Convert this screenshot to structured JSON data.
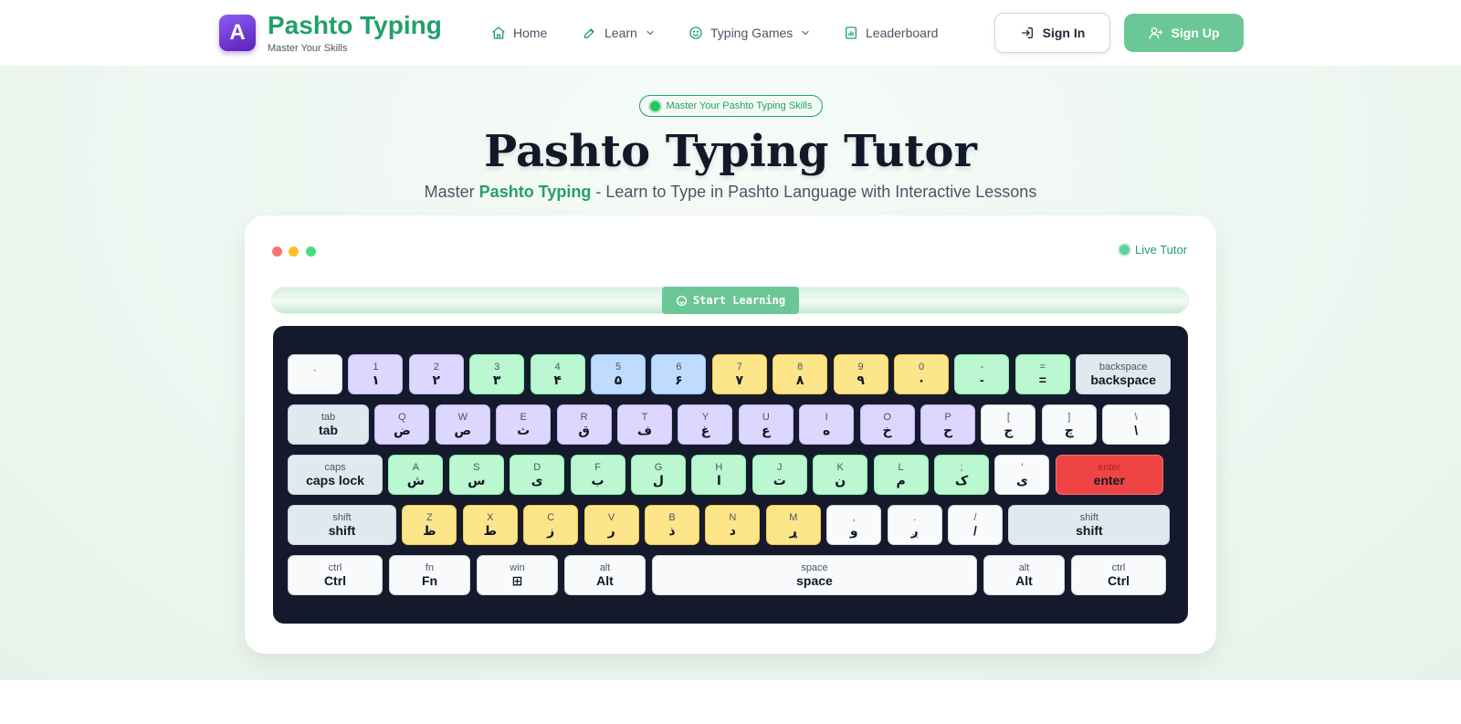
{
  "nav": {
    "logo_letter": "A",
    "brand_title": "Pashto Typing",
    "brand_sub": "Master Your Skills",
    "items": [
      {
        "label": "Home"
      },
      {
        "label": "Learn"
      },
      {
        "label": "Typing Games"
      },
      {
        "label": "Leaderboard"
      }
    ],
    "sign_in": "Sign In",
    "sign_up": "Sign Up"
  },
  "hero": {
    "pill": "Master Your Pashto Typing Skills",
    "title": "Pashto Typing Tutor",
    "sub_pre": "Master ",
    "sub_hl": "Pashto Typing",
    "sub_post": " - Learn to Type in Pashto Language with Interactive Lessons"
  },
  "card": {
    "live_label": "Live Tutor",
    "start_label": "Start Learning"
  },
  "colors": {
    "brand_green": "#22a06b",
    "button_green": "#6cc796",
    "purple": "#ddd6fe",
    "green": "#bbf7d0",
    "blue": "#bfdbfe",
    "yellow": "#fde68a",
    "gray": "#e2e8f0",
    "red": "#ef4444",
    "keyboard_bg": "#141a2c"
  },
  "keyboard": {
    "rows": [
      [
        {
          "top": "`",
          "bottom": "",
          "color": "white"
        },
        {
          "top": "1",
          "bottom": "١",
          "color": "purple"
        },
        {
          "top": "2",
          "bottom": "٢",
          "color": "purple"
        },
        {
          "top": "3",
          "bottom": "٣",
          "color": "green"
        },
        {
          "top": "4",
          "bottom": "۴",
          "color": "green"
        },
        {
          "top": "5",
          "bottom": "۵",
          "color": "blue"
        },
        {
          "top": "6",
          "bottom": "۶",
          "color": "blue"
        },
        {
          "top": "7",
          "bottom": "٧",
          "color": "yellow"
        },
        {
          "top": "8",
          "bottom": "٨",
          "color": "yellow"
        },
        {
          "top": "9",
          "bottom": "٩",
          "color": "yellow"
        },
        {
          "top": "0",
          "bottom": "٠",
          "color": "yellow"
        },
        {
          "top": "-",
          "bottom": "-",
          "color": "green"
        },
        {
          "top": "=",
          "bottom": "=",
          "color": "green"
        },
        {
          "top": "backspace",
          "bottom": "backspace",
          "color": "gray"
        }
      ],
      [
        {
          "top": "tab",
          "bottom": "tab",
          "color": "gray"
        },
        {
          "top": "Q",
          "bottom": "ض",
          "color": "purple"
        },
        {
          "top": "W",
          "bottom": "ص",
          "color": "purple"
        },
        {
          "top": "E",
          "bottom": "ث",
          "color": "purple"
        },
        {
          "top": "R",
          "bottom": "ق",
          "color": "purple"
        },
        {
          "top": "T",
          "bottom": "ف",
          "color": "purple"
        },
        {
          "top": "Y",
          "bottom": "غ",
          "color": "purple"
        },
        {
          "top": "U",
          "bottom": "ع",
          "color": "purple"
        },
        {
          "top": "I",
          "bottom": "ه",
          "color": "purple"
        },
        {
          "top": "O",
          "bottom": "خ",
          "color": "purple"
        },
        {
          "top": "P",
          "bottom": "ح",
          "color": "purple"
        },
        {
          "top": "[",
          "bottom": "ج",
          "color": "white"
        },
        {
          "top": "]",
          "bottom": "چ",
          "color": "white"
        },
        {
          "top": "\\",
          "bottom": "\\",
          "color": "white"
        }
      ],
      [
        {
          "top": "caps",
          "bottom": "caps lock",
          "color": "gray"
        },
        {
          "top": "A",
          "bottom": "ش",
          "color": "green"
        },
        {
          "top": "S",
          "bottom": "س",
          "color": "green"
        },
        {
          "top": "D",
          "bottom": "ی",
          "color": "green"
        },
        {
          "top": "F",
          "bottom": "ب",
          "color": "green"
        },
        {
          "top": "G",
          "bottom": "ل",
          "color": "green"
        },
        {
          "top": "H",
          "bottom": "ا",
          "color": "green"
        },
        {
          "top": "J",
          "bottom": "ت",
          "color": "green"
        },
        {
          "top": "K",
          "bottom": "ن",
          "color": "green"
        },
        {
          "top": "L",
          "bottom": "م",
          "color": "green"
        },
        {
          "top": ";",
          "bottom": "ک",
          "color": "green"
        },
        {
          "top": "'",
          "bottom": "ی",
          "color": "white"
        },
        {
          "top": "enter",
          "bottom": "enter",
          "color": "red"
        }
      ],
      [
        {
          "top": "shift",
          "bottom": "shift",
          "color": "gray"
        },
        {
          "top": "Z",
          "bottom": "ظ",
          "color": "yellow"
        },
        {
          "top": "X",
          "bottom": "ط",
          "color": "yellow"
        },
        {
          "top": "C",
          "bottom": "ز",
          "color": "yellow"
        },
        {
          "top": "V",
          "bottom": "ر",
          "color": "yellow"
        },
        {
          "top": "B",
          "bottom": "ذ",
          "color": "yellow"
        },
        {
          "top": "N",
          "bottom": "د",
          "color": "yellow"
        },
        {
          "top": "M",
          "bottom": "ړ",
          "color": "yellow"
        },
        {
          "top": ",",
          "bottom": "و",
          "color": "white"
        },
        {
          "top": ".",
          "bottom": "ږ",
          "color": "white"
        },
        {
          "top": "/",
          "bottom": "/",
          "color": "white"
        },
        {
          "top": "shift",
          "bottom": "shift",
          "color": "gray"
        }
      ],
      [
        {
          "top": "ctrl",
          "bottom": "Ctrl",
          "color": "white"
        },
        {
          "top": "fn",
          "bottom": "Fn",
          "color": "white"
        },
        {
          "top": "win",
          "bottom": "⊞",
          "color": "white"
        },
        {
          "top": "alt",
          "bottom": "Alt",
          "color": "white"
        },
        {
          "top": "space",
          "bottom": "space",
          "color": "white"
        },
        {
          "top": "alt",
          "bottom": "Alt",
          "color": "white"
        },
        {
          "top": "ctrl",
          "bottom": "Ctrl",
          "color": "white"
        }
      ]
    ]
  }
}
